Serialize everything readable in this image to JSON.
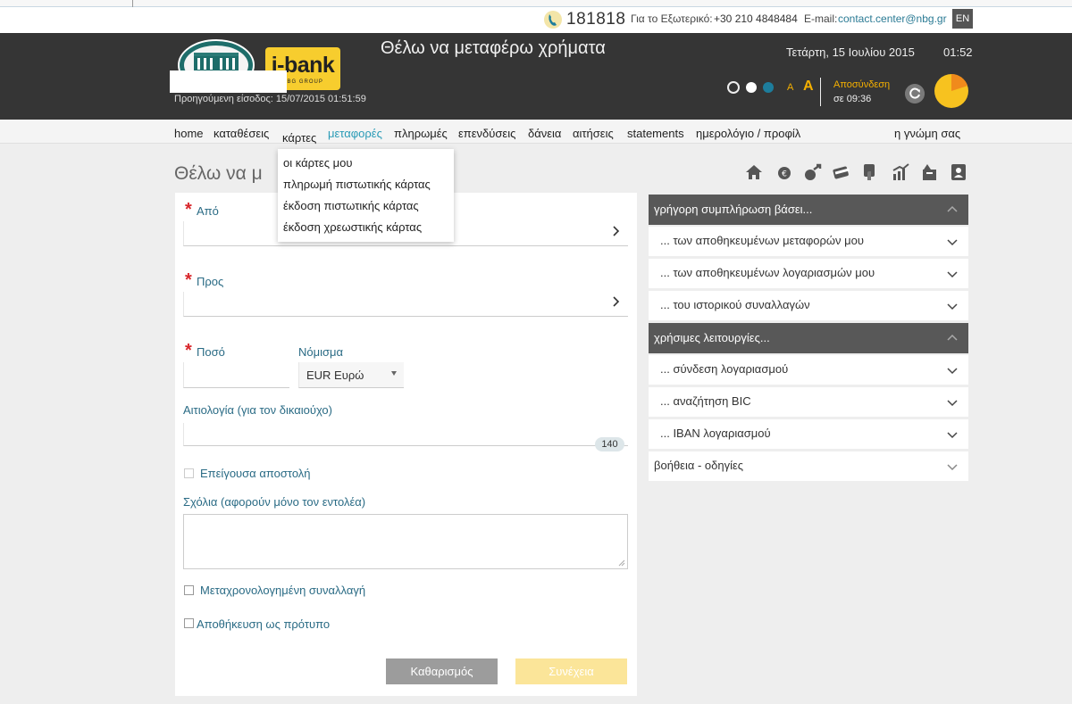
{
  "contact": {
    "phone": "181818",
    "abroad_label": "Για το Εξωτερικό:",
    "abroad_phone": "+30 210 4848484",
    "email_label": "E-mail:",
    "email": "contact.center@nbg.gr",
    "language": "EN"
  },
  "header": {
    "logo_main": "i-bank",
    "logo_sub": "NBG GROUP",
    "page_heading": "Θέλω να μεταφέρω χρήματα",
    "date": "Τετάρτη, 15 Ιουλίου 2015",
    "time": "01:52",
    "previous_login": "Προηγούμενη είσοδος: 15/07/2015 01:51:59",
    "font_small": "A",
    "font_big": "A",
    "logout_label": "Αποσύνδεση",
    "logout_time": "σε 09:36",
    "session_remaining_fraction": 0.8,
    "colors": {
      "accent": "#f5b000",
      "header_bg": "#353535",
      "link": "#2a9bb6"
    }
  },
  "nav": {
    "items": [
      {
        "label": "home"
      },
      {
        "label": "καταθέσεις"
      },
      {
        "label": "κάρτες"
      },
      {
        "label": "μεταφορές"
      },
      {
        "label": "πληρωμές"
      },
      {
        "label": "επενδύσεις"
      },
      {
        "label": "δάνεια"
      },
      {
        "label": "αιτήσεις"
      },
      {
        "label": "statements"
      },
      {
        "label": "ημερολόγιο / προφίλ"
      }
    ],
    "feedback": "η γνώμη σας",
    "dropdown": [
      "οι κάρτες μου",
      "πληρωμή πιστωτικής κάρτας",
      "έκδοση πιστωτικής κάρτας",
      "έκδοση χρεωστικής κάρτας"
    ]
  },
  "page_title": "Θέλω να μ",
  "toolbar_icons": [
    "home-icon",
    "euro-icon",
    "transfer-icon",
    "cards-icon",
    "payment-icon",
    "investments-icon",
    "loans-icon",
    "contacts-icon"
  ],
  "form": {
    "from_label": "Από",
    "to_label": "Προς",
    "amount_label": "Ποσό",
    "currency_label": "Νόμισμα",
    "currency_value": "EUR Ευρώ",
    "reason_label": "Αιτιολογία (για τον δικαιούχο)",
    "reason_counter": "140",
    "urgent_label": "Επείγουσα αποστολή",
    "comments_label": "Σχόλια (αφορούν μόνο τον εντολέα)",
    "scheduled_label": "Μεταχρονολογημένη συναλλαγή",
    "save_template_label": "Αποθήκευση ως πρότυπο",
    "clear_button": "Καθαρισμός",
    "next_button": "Συνέχεια"
  },
  "side_panel": {
    "quick_fill": {
      "title": "γρήγορη συμπλήρωση βάσει...",
      "items": [
        "... των αποθηκευμένων μεταφορών μου",
        "... των αποθηκευμένων λογαριασμών μου",
        "... του ιστορικού συναλλαγών"
      ]
    },
    "useful": {
      "title": "χρήσιμες λειτουργίες...",
      "items": [
        "... σύνδεση λογαριασμού",
        "... αναζήτηση BIC",
        "... IBAN λογαριασμού"
      ]
    },
    "help": "βοήθεια - οδηγίες"
  }
}
